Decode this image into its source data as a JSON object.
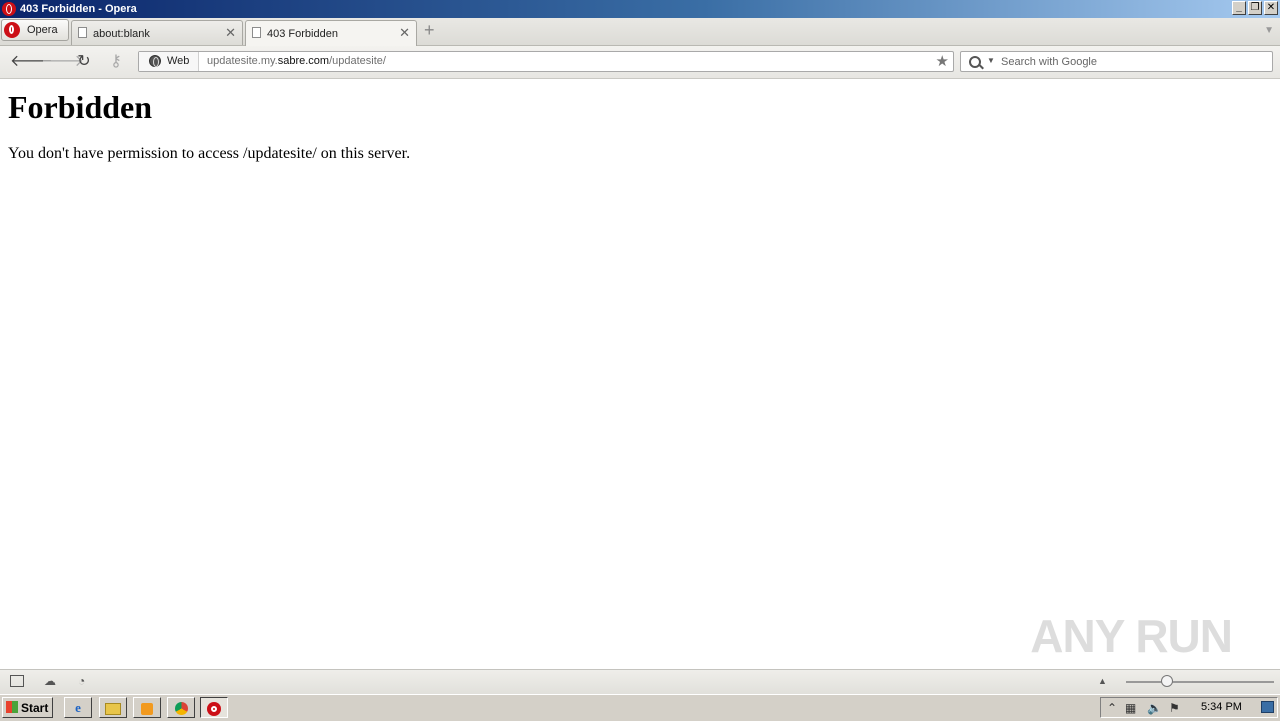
{
  "window": {
    "title": "403 Forbidden - Opera",
    "buttons": {
      "minimize": "_",
      "restore": "❐",
      "close": "✕"
    }
  },
  "tabbar": {
    "menu_label": "Opera",
    "tabs": [
      {
        "label": "about:blank",
        "active": false
      },
      {
        "label": "403 Forbidden",
        "active": true
      }
    ],
    "new_tab_icon": "plus-icon",
    "close_glyph": "✕"
  },
  "addressbar": {
    "back_icon": "back-arrow-icon",
    "forward_icon": "forward-arrow-icon",
    "reload_icon": "reload-icon",
    "key_icon": "key-icon",
    "web_badge": "Web",
    "url_prefix": "updatesite.my.",
    "url_host": "sabre.com",
    "url_suffix": "/updatesite/",
    "search_placeholder": "Search with Google"
  },
  "page": {
    "heading": "Forbidden",
    "message": "You don't have permission to access /updatesite/ on this server."
  },
  "watermark": "ANY RUN",
  "statusbar": {
    "icons": [
      "panel-icon",
      "cloud-icon",
      "speed-dial-icon"
    ],
    "zoom_level": 0.27
  },
  "taskbar": {
    "start_label": "Start",
    "clock": "5:34 PM",
    "items": [
      "internet-explorer-icon",
      "folder-icon",
      "media-player-icon",
      "chrome-icon",
      "opera-icon"
    ]
  },
  "colors": {
    "title_gradient_start": "#0a246a",
    "opera_red": "#cc0f16",
    "taskbar": "#d4d0c8"
  }
}
